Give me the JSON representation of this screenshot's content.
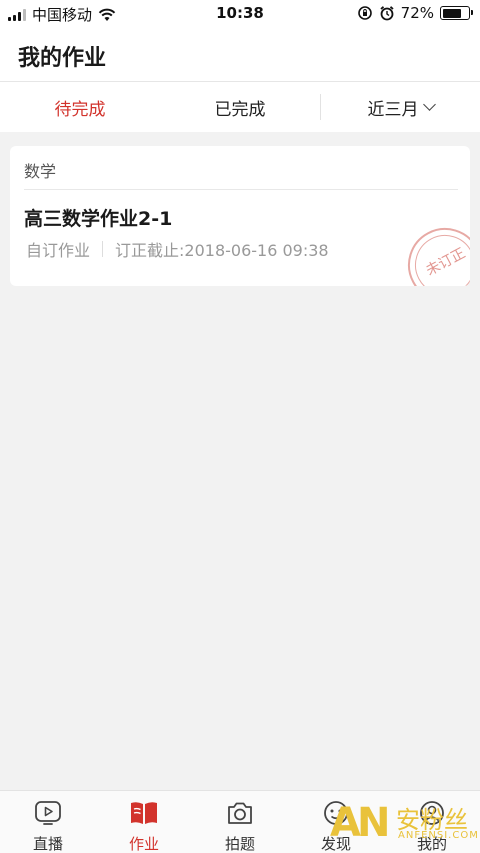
{
  "status_bar": {
    "carrier": "中国移动",
    "time": "10:38",
    "battery": "72%",
    "battery_level": 0.72
  },
  "header": {
    "title": "我的作业"
  },
  "tabs": {
    "pending": "待完成",
    "done": "已完成",
    "range": "近三月"
  },
  "card": {
    "subject": "数学",
    "title": "高三数学作业2-1",
    "type": "自订作业",
    "deadline": "订正截止:2018-06-16 09:38",
    "stamp": "未订正"
  },
  "bottom_nav": [
    {
      "label": "直播",
      "icon": "play-video-icon"
    },
    {
      "label": "作业",
      "icon": "open-book-icon",
      "active": true
    },
    {
      "label": "拍题",
      "icon": "camera-icon"
    },
    {
      "label": "发现",
      "icon": "face-icon"
    },
    {
      "label": "我的",
      "icon": "profile-icon"
    }
  ],
  "watermark": {
    "logo": "AN",
    "text_cn": "安粉丝",
    "text_en": "ANFENSI.COM"
  },
  "colors": {
    "accent": "#d2332c",
    "background": "#f2f2f2",
    "stamp": "#e29690",
    "watermark": "#e9c23b"
  }
}
